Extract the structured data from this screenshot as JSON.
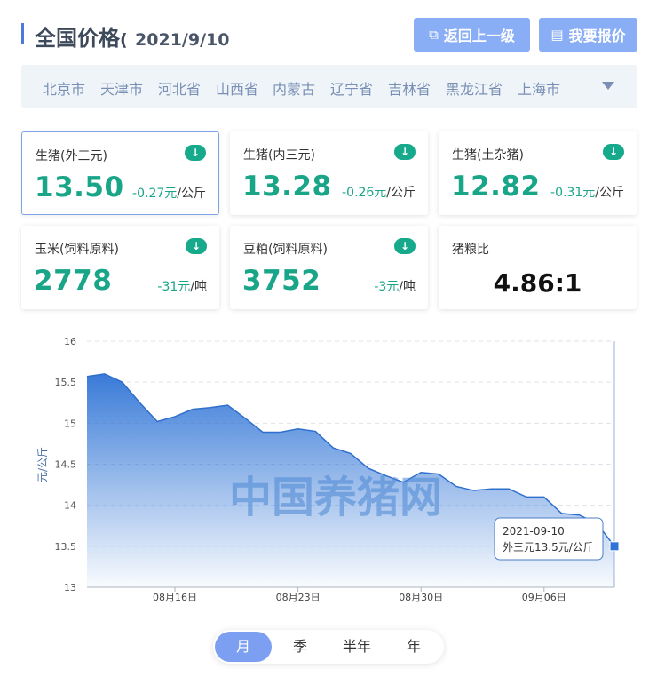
{
  "header": {
    "title": "全国价格",
    "paren": "(",
    "date": "2021/9/10",
    "back_button": "返回上一级",
    "quote_button": "我要报价"
  },
  "regions": [
    "北京市",
    "天津市",
    "河北省",
    "山西省",
    "内蒙古",
    "辽宁省",
    "吉林省",
    "黑龙江省",
    "上海市"
  ],
  "cards": [
    {
      "name": "生猪(外三元)",
      "value": "13.50",
      "change": "-0.27元",
      "unit": "/公斤"
    },
    {
      "name": "生猪(内三元)",
      "value": "13.28",
      "change": "-0.26元",
      "unit": "/公斤"
    },
    {
      "name": "生猪(土杂猪)",
      "value": "12.82",
      "change": "-0.31元",
      "unit": "/公斤"
    },
    {
      "name": "玉米(饲料原料)",
      "value": "2778",
      "change": "-31元",
      "unit": "/吨"
    },
    {
      "name": "豆粕(饲料原料)",
      "value": "3752",
      "change": "-3元",
      "unit": "/吨"
    }
  ],
  "ratio_card": {
    "name": "猪粮比",
    "value": "4.86:1"
  },
  "colors": {
    "accent": "#4a7bd8",
    "button": "#8aaef5",
    "down": "#16a98c",
    "series": "#3a7bd5"
  },
  "chart_data": {
    "type": "area",
    "ylabel": "元/公斤",
    "ylim": [
      13,
      16
    ],
    "yticks": [
      13,
      13.5,
      14,
      14.5,
      15,
      15.5,
      16
    ],
    "x": [
      "2021-08-11",
      "2021-08-12",
      "2021-08-13",
      "2021-08-14",
      "2021-08-15",
      "2021-08-16",
      "2021-08-17",
      "2021-08-18",
      "2021-08-19",
      "2021-08-20",
      "2021-08-21",
      "2021-08-22",
      "2021-08-23",
      "2021-08-24",
      "2021-08-25",
      "2021-08-26",
      "2021-08-27",
      "2021-08-28",
      "2021-08-29",
      "2021-08-30",
      "2021-08-31",
      "2021-09-01",
      "2021-09-02",
      "2021-09-03",
      "2021-09-04",
      "2021-09-05",
      "2021-09-06",
      "2021-09-07",
      "2021-09-08",
      "2021-09-09",
      "2021-09-10"
    ],
    "values": [
      15.57,
      15.6,
      15.5,
      15.25,
      15.02,
      15.08,
      15.17,
      15.19,
      15.22,
      15.06,
      14.89,
      14.89,
      14.93,
      14.9,
      14.7,
      14.63,
      14.45,
      14.36,
      14.28,
      14.4,
      14.38,
      14.23,
      14.18,
      14.2,
      14.2,
      14.1,
      14.1,
      13.9,
      13.88,
      13.78,
      13.5
    ],
    "xtick_labels": [
      {
        "date": "2021-08-16",
        "label": "08月16日"
      },
      {
        "date": "2021-08-23",
        "label": "08月23日"
      },
      {
        "date": "2021-08-30",
        "label": "08月30日"
      },
      {
        "date": "2021-09-06",
        "label": "09月06日"
      }
    ],
    "grid": true,
    "watermark": "中国养猪网",
    "tooltip": {
      "date": "2021-09-10",
      "text": "外三元13.5元/公斤"
    }
  },
  "range_tabs": [
    "月",
    "季",
    "半年",
    "年"
  ],
  "active_range": 0
}
